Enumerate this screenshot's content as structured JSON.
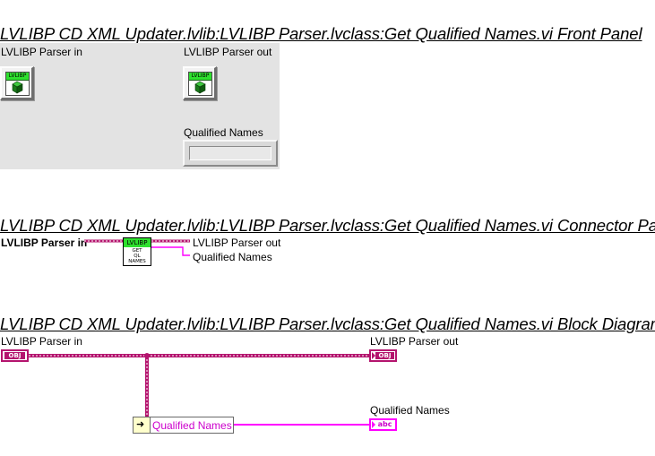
{
  "front_panel": {
    "title": "LVLIBP CD XML Updater.lvlib:LVLIBP Parser.lvclass:Get Qualified Names.vi Front Panel",
    "parser_in_label": "LVLIBP Parser in",
    "parser_out_label": "LVLIBP Parser out",
    "qualified_names_label": "Qualified Names",
    "class_tag": "LVLIBP"
  },
  "connector_pane": {
    "title": "LVLIBP CD XML Updater.lvlib:LVLIBP Parser.lvclass:Get Qualified Names.vi Connector Pane",
    "input_label": "LVLIBP Parser in",
    "output_label": "LVLIBP Parser out",
    "output2_label": "Qualified Names",
    "icon_tag": "LVLIBP",
    "icon_line1": "GET",
    "icon_line2": "QL",
    "icon_line3": "NAMES"
  },
  "block_diagram": {
    "title": "LVLIBP CD XML Updater.lvlib:LVLIBP Parser.lvclass:Get Qualified Names.vi Block Diagram",
    "in_label": "LVLIBP Parser in",
    "out_label": "LVLIBP Parser out",
    "qn_label": "Qualified Names",
    "in_terminal": "OBJ",
    "out_terminal": "OBJ",
    "qn_terminal": "abc",
    "property_node_item": "Qualified Names"
  },
  "colors": {
    "class_wire": "#b4146e",
    "string_wire": "#ff00ff",
    "green_tag": "#2ee02e",
    "panel_bg": "#e3e3e3"
  }
}
